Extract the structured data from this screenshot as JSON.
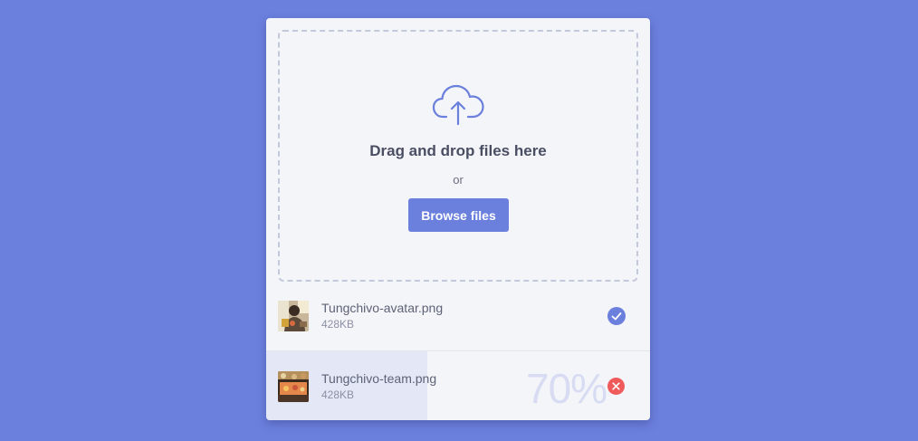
{
  "dropzone": {
    "icon": "cloud-upload-icon",
    "title": "Drag and drop files here",
    "or_text": "or",
    "browse_label": "Browse files"
  },
  "files": [
    {
      "name": "Tungchivo-avatar.png",
      "size": "428KB",
      "status": "complete",
      "status_icon": "check-circle-icon"
    },
    {
      "name": "Tungchivo-team.png",
      "size": "428KB",
      "status": "uploading",
      "progress_percent": 70,
      "progress_label": "70%",
      "status_icon": "close-circle-icon"
    }
  ],
  "colors": {
    "background": "#6b7fdd",
    "accent": "#6b7fdd",
    "card": "#f4f5f9",
    "error": "#ef5b5b",
    "progress_fill": "#e4e7f6"
  }
}
